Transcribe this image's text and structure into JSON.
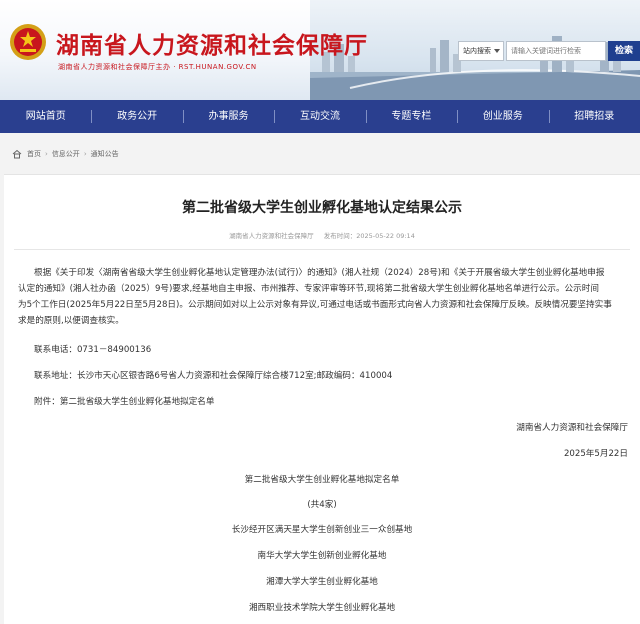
{
  "header": {
    "title": "湖南省人力资源和社会保障厅",
    "subtitle": "湖南省人力资源和社会保障厅主办 · RST.HUNAN.GOV.CN",
    "search": {
      "scope": "站内搜索",
      "placeholder": "请输入关键词进行检索",
      "button": "检索"
    }
  },
  "nav": [
    "网站首页",
    "政务公开",
    "办事服务",
    "互动交流",
    "专题专栏",
    "创业服务",
    "招聘招录"
  ],
  "breadcrumb": [
    "首页",
    "信息公开",
    "通知公告"
  ],
  "article": {
    "title": "第二批省级大学生创业孵化基地认定结果公示",
    "source": "湖南省人力资源和社会保障厅",
    "date_label": "发布时间：",
    "date": "2025-05-22 09:14",
    "body_lines": [
      "根据《关于印发〈湖南省省级大学生创业孵化基地认定管理办法(试行)〉的通知》(湘人社规（2024）28号)和《关于开展省级大学生创业孵化基地申报",
      "认定的通知》(湘人社办函（2025）9号)要求,经基地自主申报、市州推荐、专家评审等环节,现将第二批省级大学生创业孵化基地名单进行公示。公示时间",
      "为5个工作日(2025年5月22日至5月28日)。公示期间如对以上公示对象有异议,可通过电话或书面形式向省人力资源和社会保障厅反映。反映情况要坚持实事",
      "求是的原则,以便调查核实。"
    ],
    "phone": "联系电话：0731－84900136",
    "address": "联系地址：长沙市天心区银杏路6号省人力资源和社会保障厅综合楼712室;邮政编码：410004",
    "attachment": "附件：第二批省级大学生创业孵化基地拟定名单",
    "signature": "湖南省人力资源和社会保障厅",
    "sign_date": "2025年5月22日",
    "list_title": "第二批省级大学生创业孵化基地拟定名单",
    "list_count": "(共4家)",
    "list": [
      "长沙经开区满天星大学生创新创业三一众创基地",
      "南华大学大学生创新创业孵化基地",
      "湘潭大学大学生创业孵化基地",
      "湘西职业技术学院大学生创业孵化基地"
    ]
  },
  "colors": {
    "brand_red": "#c8161d",
    "nav_blue": "#2a3f8f"
  }
}
